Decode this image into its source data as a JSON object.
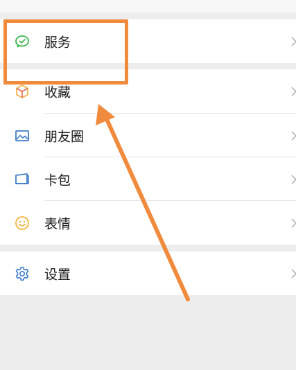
{
  "menu": {
    "items": [
      {
        "label": "服务",
        "icon": "wechat-pay-icon"
      },
      {
        "label": "收藏",
        "icon": "favorites-cube-icon"
      },
      {
        "label": "朋友圈",
        "icon": "moments-image-icon"
      },
      {
        "label": "卡包",
        "icon": "card-wallet-icon"
      },
      {
        "label": "表情",
        "icon": "sticker-smile-icon"
      },
      {
        "label": "设置",
        "icon": "settings-gear-icon"
      }
    ]
  },
  "colors": {
    "highlight": "#f08a3c",
    "service_icon": "#39b54a",
    "favorites_icon": "#f2b24b",
    "moments_icon": "#3d7cc9",
    "card_icon": "#3d7cc9",
    "sticker_icon": "#f4b33c",
    "settings_icon": "#3d7cc9"
  }
}
